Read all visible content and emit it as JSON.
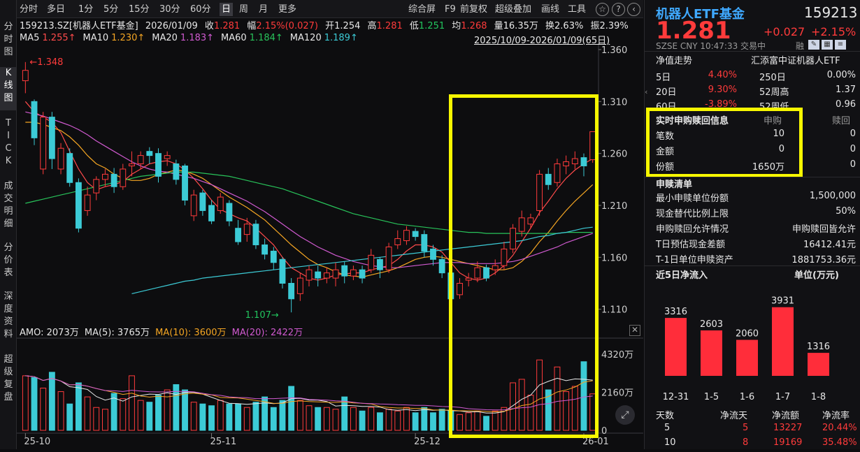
{
  "left_rail": [
    "分时图",
    "K线图",
    "TICK",
    "成交明细",
    "分价表",
    "深度资料",
    "超级复盘"
  ],
  "toolbar": {
    "periods": [
      "分时",
      "多日",
      "1分",
      "5分",
      "15分",
      "30分",
      "60分",
      "日",
      "周",
      "月",
      "更多"
    ],
    "active_period": "日",
    "tools": [
      "综合屏",
      "F9",
      "前复权",
      "超级叠加",
      "画线",
      "工具"
    ],
    "icons": [
      "favorite-icon",
      "help-icon",
      "back-icon",
      "forward-icon"
    ]
  },
  "info": {
    "code_name": "159213.SZ[机器人ETF基金]",
    "date": "2026/01/09",
    "close_label": "收",
    "close": "1.281",
    "change_label": "幅",
    "change": "2.15%(0.027)",
    "open_label": "开",
    "open": "1.254",
    "high_label": "高",
    "high": "1.281",
    "low_label": "低",
    "low": "1.251",
    "avg_label": "均",
    "avg": "1.268",
    "vol_label": "量",
    "vol": "16.35万",
    "turnover_label": "换",
    "turnover": "2.63%",
    "amp_label": "振",
    "amp": "2.39%",
    "range": "2025/10/09-2026/01/09(65日)"
  },
  "ma_legend": [
    {
      "name": "MA5",
      "value": "1.255↑",
      "color": "#ff4b4b"
    },
    {
      "name": "MA10",
      "value": "1.230↑",
      "color": "#f5a623"
    },
    {
      "name": "MA20",
      "value": "1.183↑",
      "color": "#d05ad0"
    },
    {
      "name": "MA60",
      "value": "1.184↑",
      "color": "#28c35a"
    },
    {
      "name": "MA120",
      "value": "1.189↑",
      "color": "#3ccbd6"
    }
  ],
  "vol_legend": {
    "amo": "AMO: 2073万",
    "ma5": "MA(5): 3765万",
    "ma10": "MA(10): 3600万",
    "ma20": "MA(20): 2422万"
  },
  "chart_data": {
    "type": "candlestick",
    "price_axis": {
      "ticks": [
        "1.360",
        "1.310",
        "1.260",
        "1.210",
        "1.160",
        "1.110"
      ],
      "ylim": [
        1.097,
        1.362
      ]
    },
    "volume_axis": {
      "ticks": [
        "4320万",
        "2160万",
        "0"
      ]
    },
    "x_ticks": [
      "25-10",
      "25-11",
      "25-12",
      "26-01"
    ],
    "annotations": {
      "high_label": "1.348",
      "low_label": "1.107"
    },
    "candles": [
      [
        1.33,
        1.34,
        1.348,
        1.318,
        3100
      ],
      [
        1.31,
        1.275,
        1.312,
        1.268,
        3000
      ],
      [
        1.245,
        1.295,
        1.3,
        1.24,
        2400
      ],
      [
        1.295,
        1.255,
        1.3,
        1.245,
        3300
      ],
      [
        1.245,
        1.265,
        1.27,
        1.24,
        2200
      ],
      [
        1.26,
        1.232,
        1.265,
        1.228,
        1500
      ],
      [
        1.232,
        1.188,
        1.236,
        1.184,
        2700
      ],
      [
        1.205,
        1.22,
        1.228,
        1.2,
        1900
      ],
      [
        1.222,
        1.235,
        1.238,
        1.215,
        1300
      ],
      [
        1.235,
        1.24,
        1.245,
        1.228,
        1200
      ],
      [
        1.24,
        1.228,
        1.246,
        1.222,
        2100
      ],
      [
        1.228,
        1.245,
        1.25,
        1.225,
        1800
      ],
      [
        1.248,
        1.25,
        1.262,
        1.238,
        3100
      ],
      [
        1.25,
        1.258,
        1.262,
        1.245,
        1700
      ],
      [
        1.262,
        1.258,
        1.266,
        1.25,
        1600
      ],
      [
        1.26,
        1.238,
        1.265,
        1.232,
        2000
      ],
      [
        1.255,
        1.258,
        1.262,
        1.248,
        2300
      ],
      [
        1.25,
        1.235,
        1.254,
        1.23,
        2600
      ],
      [
        1.248,
        1.215,
        1.25,
        1.21,
        2300
      ],
      [
        1.2,
        1.22,
        1.225,
        1.195,
        1600
      ],
      [
        1.222,
        1.205,
        1.225,
        1.2,
        1500
      ],
      [
        1.21,
        1.195,
        1.215,
        1.192,
        1400
      ],
      [
        1.205,
        1.218,
        1.222,
        1.202,
        1700
      ],
      [
        1.212,
        1.195,
        1.215,
        1.19,
        1500
      ],
      [
        1.188,
        1.175,
        1.196,
        1.172,
        1500
      ],
      [
        1.182,
        1.192,
        1.198,
        1.175,
        1300
      ],
      [
        1.192,
        1.172,
        1.196,
        1.168,
        1600
      ],
      [
        1.172,
        1.163,
        1.178,
        1.158,
        1900
      ],
      [
        1.166,
        1.155,
        1.17,
        1.148,
        1300
      ],
      [
        1.158,
        1.135,
        1.16,
        1.13,
        1700
      ],
      [
        1.135,
        1.12,
        1.14,
        1.107,
        2500
      ],
      [
        1.125,
        1.14,
        1.145,
        1.118,
        1700
      ],
      [
        1.138,
        1.148,
        1.152,
        1.132,
        1400
      ],
      [
        1.146,
        1.14,
        1.152,
        1.132,
        1300
      ],
      [
        1.14,
        1.145,
        1.15,
        1.135,
        1300
      ],
      [
        1.14,
        1.148,
        1.155,
        1.132,
        1200
      ],
      [
        1.152,
        1.142,
        1.156,
        1.135,
        1900
      ],
      [
        1.142,
        1.148,
        1.152,
        1.138,
        1300
      ],
      [
        1.148,
        1.14,
        1.152,
        1.135,
        1100
      ],
      [
        1.148,
        1.162,
        1.168,
        1.145,
        1300
      ],
      [
        1.158,
        1.148,
        1.16,
        1.14,
        1000
      ],
      [
        1.148,
        1.17,
        1.174,
        1.145,
        1200
      ],
      [
        1.172,
        1.178,
        1.186,
        1.168,
        1100
      ],
      [
        1.176,
        1.186,
        1.19,
        1.172,
        1300
      ],
      [
        1.185,
        1.18,
        1.188,
        1.176,
        1000
      ],
      [
        1.182,
        1.166,
        1.186,
        1.16,
        1300
      ],
      [
        1.168,
        1.158,
        1.172,
        1.152,
        1000
      ],
      [
        1.158,
        1.145,
        1.162,
        1.14,
        1200
      ],
      [
        1.145,
        1.12,
        1.15,
        1.115,
        1100
      ],
      [
        1.124,
        1.135,
        1.14,
        1.12,
        900
      ],
      [
        1.138,
        1.14,
        1.145,
        1.132,
        1000
      ],
      [
        1.14,
        1.15,
        1.156,
        1.136,
        1100
      ],
      [
        1.15,
        1.14,
        1.153,
        1.137,
        800
      ],
      [
        1.148,
        1.152,
        1.158,
        1.143,
        1100
      ],
      [
        1.152,
        1.168,
        1.175,
        1.148,
        1300
      ],
      [
        1.168,
        1.188,
        1.192,
        1.164,
        2700
      ],
      [
        1.185,
        1.198,
        1.205,
        1.18,
        2900
      ],
      [
        1.192,
        1.198,
        1.202,
        1.188,
        2000
      ],
      [
        1.205,
        1.24,
        1.244,
        1.2,
        4000
      ],
      [
        1.24,
        1.23,
        1.246,
        1.225,
        2300
      ],
      [
        1.232,
        1.25,
        1.255,
        1.228,
        3600
      ],
      [
        1.248,
        1.252,
        1.258,
        1.24,
        2200
      ],
      [
        1.25,
        1.255,
        1.262,
        1.245,
        2500
      ],
      [
        1.256,
        1.248,
        1.26,
        1.238,
        3900
      ],
      [
        1.254,
        1.281,
        1.281,
        1.251,
        2073
      ]
    ],
    "ma_lines": {
      "MA5": [
        1.31,
        1.3,
        1.295,
        1.29,
        1.28,
        1.262,
        1.245,
        1.232,
        1.225,
        1.228,
        1.23,
        1.233,
        1.24,
        1.245,
        1.25,
        1.252,
        1.253,
        1.25,
        1.244,
        1.236,
        1.226,
        1.215,
        1.206,
        1.202,
        1.198,
        1.195,
        1.188,
        1.18,
        1.172,
        1.16,
        1.15,
        1.145,
        1.14,
        1.138,
        1.14,
        1.143,
        1.144,
        1.145,
        1.145,
        1.148,
        1.15,
        1.152,
        1.158,
        1.166,
        1.172,
        1.172,
        1.17,
        1.165,
        1.155,
        1.145,
        1.14,
        1.138,
        1.14,
        1.145,
        1.152,
        1.162,
        1.175,
        1.188,
        1.203,
        1.214,
        1.226,
        1.236,
        1.244,
        1.25,
        1.255
      ],
      "MA10": [
        1.29,
        1.29,
        1.288,
        1.285,
        1.282,
        1.276,
        1.268,
        1.258,
        1.25,
        1.246,
        1.24,
        1.236,
        1.234,
        1.234,
        1.236,
        1.24,
        1.242,
        1.244,
        1.243,
        1.24,
        1.236,
        1.23,
        1.224,
        1.218,
        1.213,
        1.208,
        1.202,
        1.196,
        1.188,
        1.18,
        1.172,
        1.165,
        1.158,
        1.153,
        1.15,
        1.146,
        1.143,
        1.142,
        1.141,
        1.143,
        1.145,
        1.147,
        1.15,
        1.154,
        1.158,
        1.16,
        1.161,
        1.16,
        1.158,
        1.156,
        1.154,
        1.152,
        1.15,
        1.148,
        1.148,
        1.15,
        1.156,
        1.164,
        1.175,
        1.184,
        1.195,
        1.205,
        1.214,
        1.222,
        1.23
      ],
      "MA20": [
        1.3,
        1.298,
        1.296,
        1.293,
        1.29,
        1.287,
        1.283,
        1.278,
        1.272,
        1.267,
        1.262,
        1.257,
        1.252,
        1.248,
        1.245,
        1.243,
        1.242,
        1.24,
        1.238,
        1.236,
        1.233,
        1.23,
        1.226,
        1.222,
        1.218,
        1.214,
        1.209,
        1.204,
        1.198,
        1.192,
        1.186,
        1.18,
        1.175,
        1.17,
        1.166,
        1.162,
        1.159,
        1.156,
        1.154,
        1.152,
        1.151,
        1.15,
        1.15,
        1.151,
        1.152,
        1.153,
        1.154,
        1.155,
        1.155,
        1.155,
        1.154,
        1.154,
        1.154,
        1.154,
        1.155,
        1.156,
        1.158,
        1.161,
        1.164,
        1.167,
        1.17,
        1.174,
        1.177,
        1.18,
        1.183
      ],
      "MA60": [
        1.212,
        1.214,
        1.216,
        1.218,
        1.22,
        1.222,
        1.224,
        1.226,
        1.228,
        1.23,
        1.232,
        1.234,
        1.236,
        1.238,
        1.239,
        1.24,
        1.241,
        1.242,
        1.242,
        1.242,
        1.241,
        1.24,
        1.239,
        1.238,
        1.236,
        1.234,
        1.232,
        1.23,
        1.228,
        1.226,
        1.223,
        1.22,
        1.217,
        1.214,
        1.211,
        1.208,
        1.205,
        1.202,
        1.2,
        1.198,
        1.196,
        1.194,
        1.192,
        1.191,
        1.19,
        1.189,
        1.188,
        1.187,
        1.186,
        1.185,
        1.184,
        1.184,
        1.183,
        1.183,
        1.183,
        1.183,
        1.183,
        1.183,
        1.183,
        1.183,
        1.183,
        1.184,
        1.184,
        1.184,
        1.184
      ],
      "MA120": [
        null,
        null,
        null,
        null,
        null,
        null,
        null,
        null,
        null,
        null,
        null,
        null,
        1.125,
        1.127,
        1.129,
        1.131,
        1.133,
        1.135,
        1.137,
        1.138,
        1.14,
        1.141,
        1.142,
        1.143,
        1.144,
        1.145,
        1.146,
        1.147,
        1.148,
        1.149,
        1.15,
        1.151,
        1.152,
        1.153,
        1.154,
        1.155,
        1.156,
        1.157,
        1.158,
        1.159,
        1.16,
        1.161,
        1.162,
        1.163,
        1.164,
        1.165,
        1.166,
        1.167,
        1.168,
        1.169,
        1.17,
        1.171,
        1.172,
        1.173,
        1.174,
        1.175,
        1.176,
        1.178,
        1.18,
        1.181,
        1.183,
        1.184,
        1.186,
        1.188,
        1.189
      ]
    }
  },
  "right_panel": {
    "title": "机器人ETF基金",
    "code": "159213",
    "price": "1.281",
    "change": "+0.027",
    "change_pct": "+2.15%",
    "sub": "SZSE  CNY  10:47:33  交易中",
    "sub_right": "融",
    "nav_label": "净值走势",
    "fund_name": "汇添富中证机器人ETF",
    "perf": [
      {
        "l1": "5日",
        "v1": "4.40%",
        "l2": "250日",
        "v2": "0.00%"
      },
      {
        "l1": "20日",
        "v1": "9.30%",
        "l2": "52周高",
        "v2": "1.37"
      },
      {
        "l1": "60日",
        "v1": "-3.89%",
        "l2": "52周低",
        "v2": "0.96"
      }
    ],
    "sub_red": {
      "title": "实时申购赎回信息",
      "col1": "申购",
      "col2": "赎回",
      "rows": [
        {
          "label": "笔数",
          "v1": "10",
          "v2": "0"
        },
        {
          "label": "金额",
          "v1": "0",
          "v2": "0"
        },
        {
          "label": "份额",
          "v1": "1650万",
          "v2": "0"
        }
      ]
    },
    "list_title": "申赎清单",
    "list": [
      {
        "label": "最小申赎单位份额",
        "value": "1,500,000"
      },
      {
        "label": "现金替代比例上限",
        "value": "50%"
      },
      {
        "label": "申购赎回允许情况",
        "value": "申购赎回皆允许"
      },
      {
        "label": "T日预估现金差额",
        "value": "16412.41元"
      },
      {
        "label": "T-1日单位申赎资产",
        "value": "1881753.36元"
      }
    ],
    "inflow_title": "近5日净流入",
    "inflow_unit": "单位(万元)",
    "inflow": [
      {
        "date": "12-31",
        "value": 3316
      },
      {
        "date": "1-5",
        "value": 2603
      },
      {
        "date": "1-6",
        "value": 2060
      },
      {
        "date": "1-7",
        "value": 3931
      },
      {
        "date": "1-8",
        "value": 1316
      }
    ],
    "table_headers": [
      "天数",
      "净流天",
      "净流额",
      "净流率"
    ],
    "table_rows": [
      [
        "5",
        "5",
        "13227",
        "20.44%"
      ],
      [
        "10",
        "8",
        "19169",
        "35.48%"
      ]
    ]
  },
  "colors": {
    "up": "#ff3b3b",
    "down": "#3ccbd6",
    "highlight": "#f7f700",
    "bg": "#0d0d0f"
  }
}
